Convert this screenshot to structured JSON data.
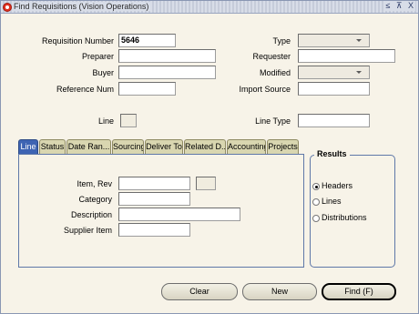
{
  "window": {
    "title": "Find Requisitions (Vision Operations)",
    "controls": "≤ ⊼ X"
  },
  "header": {
    "requisition_number_label": "Requisition Number",
    "requisition_number_value": "5646",
    "preparer_label": "Preparer",
    "buyer_label": "Buyer",
    "reference_num_label": "Reference Num",
    "type_label": "Type",
    "requester_label": "Requester",
    "modified_label": "Modified",
    "import_source_label": "Import Source",
    "line_label": "Line",
    "line_type_label": "Line Type"
  },
  "tabs": [
    {
      "label": "Line",
      "active": true
    },
    {
      "label": "Status",
      "active": false
    },
    {
      "label": "Date Ran...",
      "active": false
    },
    {
      "label": "Sourcing",
      "active": false
    },
    {
      "label": "Deliver To",
      "active": false
    },
    {
      "label": "Related D...",
      "active": false
    },
    {
      "label": "Accounting",
      "active": false
    },
    {
      "label": "Projects",
      "active": false
    }
  ],
  "line_tab": {
    "item_rev_label": "Item, Rev",
    "category_label": "Category",
    "description_label": "Description",
    "supplier_item_label": "Supplier Item"
  },
  "results": {
    "title": "Results",
    "options": [
      {
        "label": "Headers",
        "selected": true
      },
      {
        "label": "Lines",
        "selected": false
      },
      {
        "label": "Distributions",
        "selected": false
      }
    ]
  },
  "buttons": {
    "clear": "Clear",
    "new": "New",
    "find": "Find (F)"
  }
}
